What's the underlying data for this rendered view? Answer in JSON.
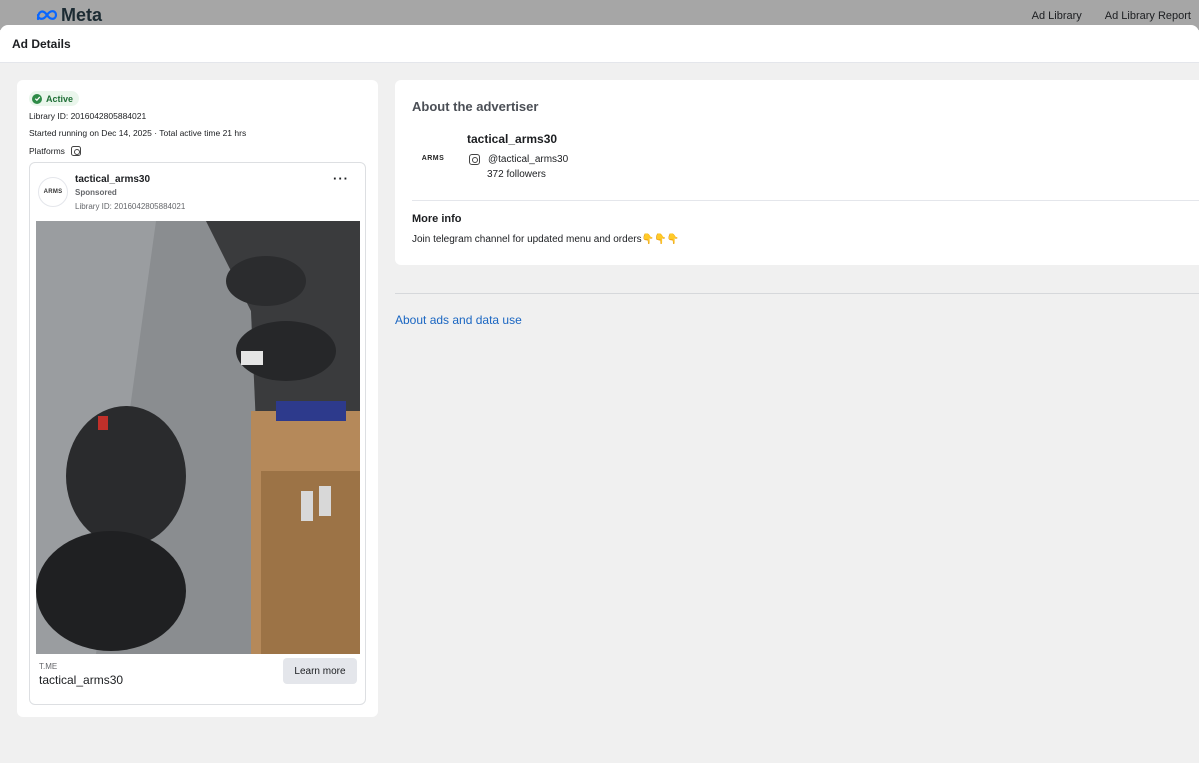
{
  "topbar": {
    "brand": "Meta",
    "links": [
      "Ad Library",
      "Ad Library Report"
    ]
  },
  "header": {
    "title": "Ad Details"
  },
  "ad_summary": {
    "status": "Active",
    "library_id": "Library ID: 2016042805884021",
    "running": "Started running on Dec 14, 2025 · Total active time 21 hrs",
    "platforms_label": "Platforms",
    "platform_icons": [
      "instagram-icon"
    ]
  },
  "ad_preview": {
    "page_name": "tactical_arms30",
    "sponsored": "Sponsored",
    "library_id": "Library ID: 2016042805884021",
    "more_label": "···",
    "logo_text": "ARMS",
    "footer_domain": "T.ME",
    "footer_name": "tactical_arms30",
    "cta_label": "Learn more"
  },
  "advertiser": {
    "section_title": "About the advertiser",
    "logo_text": "ARMS",
    "name": "tactical_arms30",
    "handle": "@tactical_arms30",
    "followers": "372 followers",
    "more_info_title": "More info",
    "more_info_text": "Join telegram channel for updated menu and orders",
    "more_info_emoji": "👇👇👇"
  },
  "footer_link": "About ads and data use",
  "colors": {
    "accent_link": "#1a66c2",
    "active_green": "#2e8b47",
    "topbar_gray": "#a6a6a6"
  }
}
